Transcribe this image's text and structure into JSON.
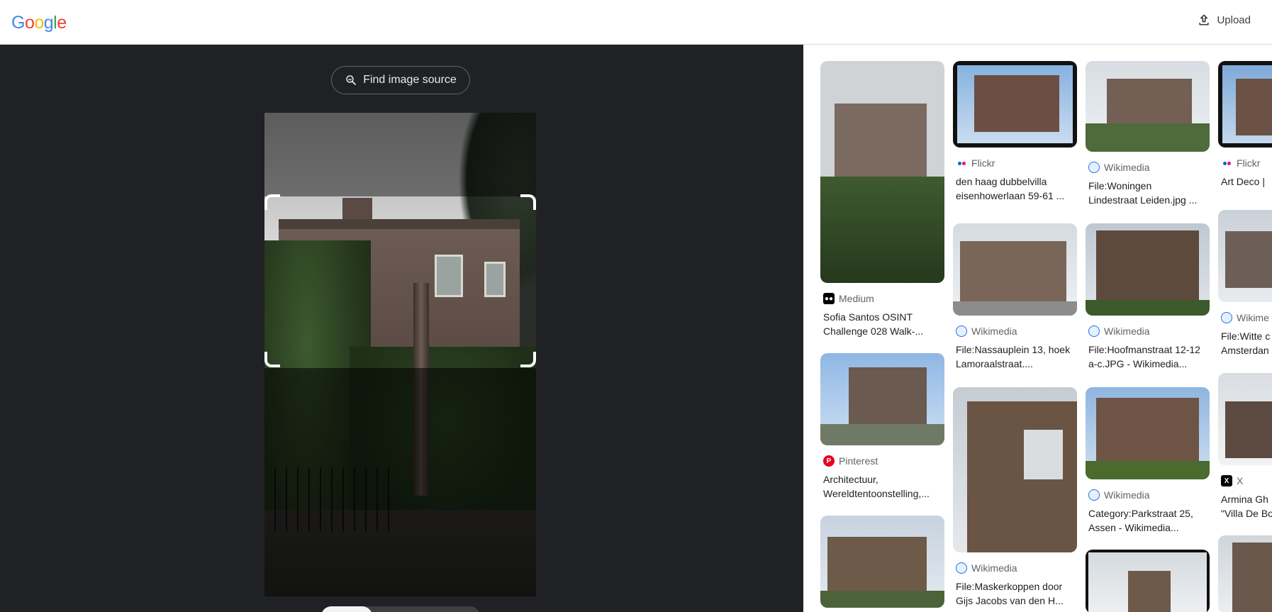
{
  "header": {
    "logo_letters": [
      "G",
      "o",
      "o",
      "g",
      "l",
      "e"
    ],
    "logo_colors": [
      "#4285F4",
      "#EA4335",
      "#FBBC05",
      "#4285F4",
      "#34A853",
      "#EA4335"
    ],
    "upload_label": "Upload"
  },
  "left": {
    "find_source_label": "Find image source"
  },
  "results": [
    {
      "source": "Medium",
      "icon": "medium-icon",
      "line1": "Sofia Santos OSINT",
      "line2": "Challenge 028 Walk-..."
    },
    {
      "source": "Pinterest",
      "icon": "pinterest-icon",
      "line1": "Architectuur,",
      "line2": "Wereldtentoonstelling,..."
    },
    {
      "source": "Flickr",
      "icon": "flickr-icon",
      "line1": "den haag dubbelvilla",
      "line2": "eisenhowerlaan 59-61 ..."
    },
    {
      "source": "Wikimedia",
      "icon": "wikimedia-icon",
      "line1": "File:Nassauplein 13, hoek",
      "line2": "Lamoraalstraat...."
    },
    {
      "source": "Wikimedia",
      "icon": "wikimedia-icon",
      "line1": "File:Maskerkoppen door",
      "line2": "Gijs Jacobs van den H..."
    },
    {
      "source": "Wikimedia",
      "icon": "wikimedia-icon",
      "line1": "File:Woningen",
      "line2": "Lindestraat Leiden.jpg ..."
    },
    {
      "source": "Wikimedia",
      "icon": "wikimedia-icon",
      "line1": "File:Hoofmanstraat 12-12",
      "line2": "a-c.JPG - Wikimedia..."
    },
    {
      "source": "Wikimedia",
      "icon": "wikimedia-icon",
      "line1": "Category:Parkstraat 25,",
      "line2": "Assen - Wikimedia..."
    },
    {
      "source": "Flickr",
      "icon": "flickr-icon",
      "line1": "Art Deco |",
      "line2": ""
    },
    {
      "source": "Wikime",
      "icon": "wikimedia-icon",
      "line1": "File:Witte c",
      "line2": "Amsterdan"
    },
    {
      "source": "X",
      "icon": "x-icon",
      "line1": "Armina Gh",
      "line2": "\"Villa De Bo"
    }
  ]
}
